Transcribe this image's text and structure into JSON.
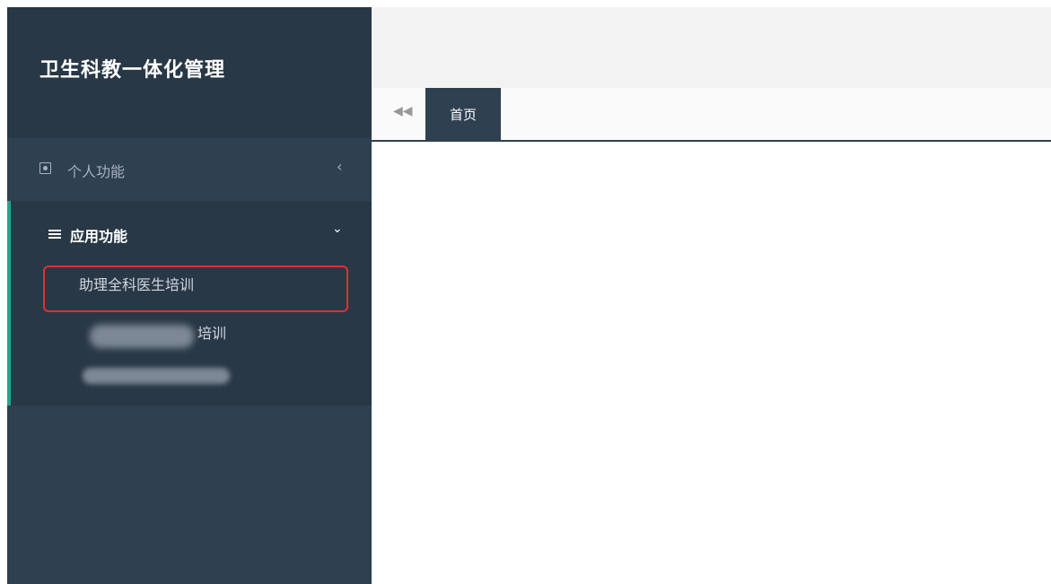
{
  "sidebar": {
    "brand_title": "卫生科教一体化管理",
    "menu": [
      {
        "label": "个人功能",
        "icon": "user-card-icon",
        "chevron": "‹"
      },
      {
        "label": "应用功能",
        "icon": "list-icon",
        "chevron": "⌄",
        "children": [
          {
            "label": "助理全科医生培训"
          },
          {
            "label": "培训"
          }
        ]
      }
    ]
  },
  "tabs": {
    "back_icon": "double-left-arrow-icon",
    "back_glyph": "◀◀",
    "items": [
      {
        "label": "首页",
        "active": true
      }
    ]
  },
  "colors": {
    "sidebar_bg": "#2f4050",
    "sidebar_dark": "#293846",
    "accent": "#19aa8d",
    "highlight": "#e0312f"
  }
}
